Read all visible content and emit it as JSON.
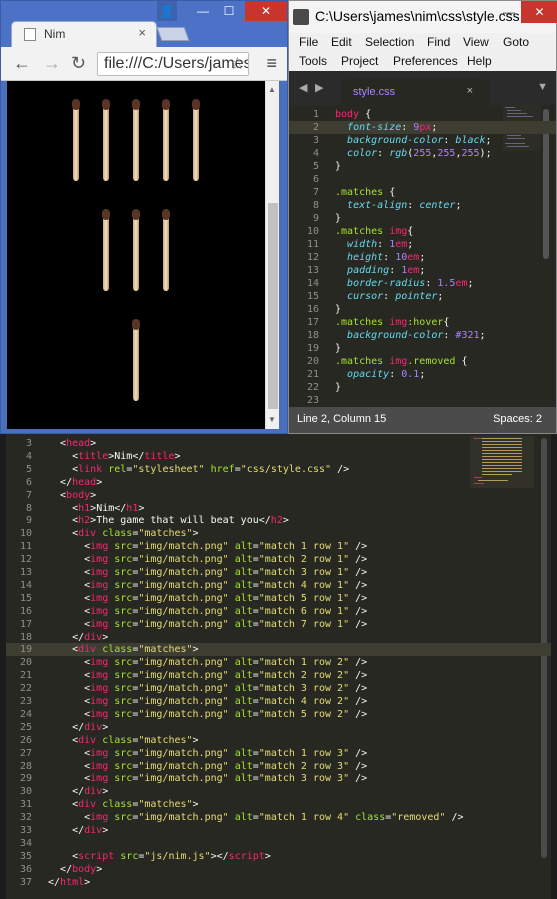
{
  "browser": {
    "tab_title": "Nim",
    "tab_close": "×",
    "url": "file:///C:/Users/james/nim/index.html",
    "win_user": "👤",
    "win_min": "—",
    "win_max": "☐",
    "win_close": "✕",
    "back": "←",
    "forward": "→",
    "reload": "↻",
    "star": "☆",
    "menu": "≡",
    "scroll_up": "▲",
    "scroll_down": "▼",
    "page_bg": "#000000",
    "match_rows": [
      5,
      3,
      1
    ],
    "removed_row": 3
  },
  "css_editor": {
    "window_title": "C:\\Users\\james\\nim\\css\\style.css",
    "win_min": "—",
    "win_close": "✕",
    "menu": [
      "File",
      "Edit",
      "Selection",
      "Find",
      "View",
      "Goto",
      "Tools",
      "Project",
      "Preferences",
      "Help"
    ],
    "tab_name": "style.css",
    "tab_close": "×",
    "prev": "◀",
    "next": "▶",
    "tab_dropdown": "▼",
    "status_left": "Line 2, Column 15",
    "status_right": "Spaces: 2",
    "current_line": 2,
    "lines": [
      {
        "n": "1",
        "html": "<span class='t'>body</span><span class='p'> {</span>"
      },
      {
        "n": "2",
        "html": "  <span class='k'>font-size</span><span class='p'>: </span><span class='n'>9</span><span class='t'>px</span><span class='p'>;</span>"
      },
      {
        "n": "3",
        "html": "  <span class='k'>background-color</span><span class='p'>: </span><span class='k'>black</span><span class='p'>;</span>"
      },
      {
        "n": "4",
        "html": "  <span class='k'>color</span><span class='p'>: </span><span class='k'>rgb</span><span class='p'>(</span><span class='n'>255</span><span class='p'>,</span><span class='n'>255</span><span class='p'>,</span><span class='n'>255</span><span class='p'>);</span>"
      },
      {
        "n": "5",
        "html": "<span class='p'>}</span>"
      },
      {
        "n": "6",
        "html": ""
      },
      {
        "n": "7",
        "html": "<span class='c'>.matches</span><span class='p'> {</span>"
      },
      {
        "n": "8",
        "html": "  <span class='k'>text-align</span><span class='p'>: </span><span class='k'>center</span><span class='p'>;</span>"
      },
      {
        "n": "9",
        "html": "<span class='p'>}</span>"
      },
      {
        "n": "10",
        "html": "<span class='c'>.matches</span><span class='p'> </span><span class='t'>img</span><span class='p'>{</span>"
      },
      {
        "n": "11",
        "html": "  <span class='k'>width</span><span class='p'>: </span><span class='n'>1</span><span class='t'>em</span><span class='p'>;</span>"
      },
      {
        "n": "12",
        "html": "  <span class='k'>height</span><span class='p'>: </span><span class='n'>10</span><span class='t'>em</span><span class='p'>;</span>"
      },
      {
        "n": "13",
        "html": "  <span class='k'>padding</span><span class='p'>: </span><span class='n'>1</span><span class='t'>em</span><span class='p'>;</span>"
      },
      {
        "n": "14",
        "html": "  <span class='k'>border-radius</span><span class='p'>: </span><span class='n'>1.5</span><span class='t'>em</span><span class='p'>;</span>"
      },
      {
        "n": "15",
        "html": "  <span class='k'>cursor</span><span class='p'>: </span><span class='k'>pointer</span><span class='p'>;</span>"
      },
      {
        "n": "16",
        "html": "<span class='p'>}</span>"
      },
      {
        "n": "17",
        "html": "<span class='c'>.matches</span><span class='p'> </span><span class='t'>img</span><span class='c'>:hover</span><span class='p'>{</span>"
      },
      {
        "n": "18",
        "html": "  <span class='k'>background-color</span><span class='p'>: </span><span class='n'>#321</span><span class='p'>;</span>"
      },
      {
        "n": "19",
        "html": "<span class='p'>}</span>"
      },
      {
        "n": "20",
        "html": "<span class='c'>.matches</span><span class='p'> </span><span class='t'>img</span><span class='c'>.removed</span><span class='p'> {</span>"
      },
      {
        "n": "21",
        "html": "  <span class='k'>opacity</span><span class='p'>: </span><span class='n'>0.1</span><span class='p'>;</span>"
      },
      {
        "n": "22",
        "html": "<span class='p'>}</span>"
      },
      {
        "n": "23",
        "html": ""
      }
    ]
  },
  "html_editor": {
    "current_line": 19,
    "lines": [
      {
        "n": "3",
        "html": "  <span class='p'>&lt;</span><span class='t'>head</span><span class='p'>&gt;</span>"
      },
      {
        "n": "4",
        "html": "    <span class='p'>&lt;</span><span class='t'>title</span><span class='p'>&gt;Nim&lt;/</span><span class='t'>title</span><span class='p'>&gt;</span>"
      },
      {
        "n": "5",
        "html": "    <span class='p'>&lt;</span><span class='t'>link</span> <span class='a'>rel</span><span class='p'>=</span><span class='s'>\"stylesheet\"</span> <span class='a'>href</span><span class='p'>=</span><span class='s'>\"css/style.css\"</span><span class='p'> /&gt;</span>"
      },
      {
        "n": "6",
        "html": "  <span class='p'>&lt;/</span><span class='t'>head</span><span class='p'>&gt;</span>"
      },
      {
        "n": "7",
        "html": "  <span class='p'>&lt;</span><span class='t'>body</span><span class='p'>&gt;</span>"
      },
      {
        "n": "8",
        "html": "    <span class='p'>&lt;</span><span class='t'>h1</span><span class='p'>&gt;Nim&lt;/</span><span class='t'>h1</span><span class='p'>&gt;</span>"
      },
      {
        "n": "9",
        "html": "    <span class='p'>&lt;</span><span class='t'>h2</span><span class='p'>&gt;The game that will beat you&lt;/</span><span class='t'>h2</span><span class='p'>&gt;</span>"
      },
      {
        "n": "10",
        "html": "    <span class='p'>&lt;</span><span class='t'>div</span> <span class='a'>class</span><span class='p'>=</span><span class='s'>\"matches\"</span><span class='p'>&gt;</span>"
      },
      {
        "n": "11",
        "html": "      <span class='p'>&lt;</span><span class='t'>img</span> <span class='a'>src</span><span class='p'>=</span><span class='s'>\"img/match.png\"</span> <span class='a'>alt</span><span class='p'>=</span><span class='s'>\"match 1 row 1\"</span><span class='p'> /&gt;</span>"
      },
      {
        "n": "12",
        "html": "      <span class='p'>&lt;</span><span class='t'>img</span> <span class='a'>src</span><span class='p'>=</span><span class='s'>\"img/match.png\"</span> <span class='a'>alt</span><span class='p'>=</span><span class='s'>\"match 2 row 1\"</span><span class='p'> /&gt;</span>"
      },
      {
        "n": "13",
        "html": "      <span class='p'>&lt;</span><span class='t'>img</span> <span class='a'>src</span><span class='p'>=</span><span class='s'>\"img/match.png\"</span> <span class='a'>alt</span><span class='p'>=</span><span class='s'>\"match 3 row 1\"</span><span class='p'> /&gt;</span>"
      },
      {
        "n": "14",
        "html": "      <span class='p'>&lt;</span><span class='t'>img</span> <span class='a'>src</span><span class='p'>=</span><span class='s'>\"img/match.png\"</span> <span class='a'>alt</span><span class='p'>=</span><span class='s'>\"match 4 row 1\"</span><span class='p'> /&gt;</span>"
      },
      {
        "n": "15",
        "html": "      <span class='p'>&lt;</span><span class='t'>img</span> <span class='a'>src</span><span class='p'>=</span><span class='s'>\"img/match.png\"</span> <span class='a'>alt</span><span class='p'>=</span><span class='s'>\"match 5 row 1\"</span><span class='p'> /&gt;</span>"
      },
      {
        "n": "16",
        "html": "      <span class='p'>&lt;</span><span class='t'>img</span> <span class='a'>src</span><span class='p'>=</span><span class='s'>\"img/match.png\"</span> <span class='a'>alt</span><span class='p'>=</span><span class='s'>\"match 6 row 1\"</span><span class='p'> /&gt;</span>"
      },
      {
        "n": "17",
        "html": "      <span class='p'>&lt;</span><span class='t'>img</span> <span class='a'>src</span><span class='p'>=</span><span class='s'>\"img/match.png\"</span> <span class='a'>alt</span><span class='p'>=</span><span class='s'>\"match 7 row 1\"</span><span class='p'> /&gt;</span>"
      },
      {
        "n": "18",
        "html": "    <span class='p'>&lt;/</span><span class='t'>div</span><span class='p'>&gt;</span>"
      },
      {
        "n": "19",
        "html": "    <span class='p'>&lt;</span><span class='t'>div</span> <span class='a'>class</span><span class='p'>=</span><span class='s'>\"matches\"</span><span class='p'>&gt;</span>"
      },
      {
        "n": "20",
        "html": "      <span class='p'>&lt;</span><span class='t'>img</span> <span class='a'>src</span><span class='p'>=</span><span class='s'>\"img/match.png\"</span> <span class='a'>alt</span><span class='p'>=</span><span class='s'>\"match 1 row 2\"</span><span class='p'> /&gt;</span>"
      },
      {
        "n": "21",
        "html": "      <span class='p'>&lt;</span><span class='t'>img</span> <span class='a'>src</span><span class='p'>=</span><span class='s'>\"img/match.png\"</span> <span class='a'>alt</span><span class='p'>=</span><span class='s'>\"match 2 row 2\"</span><span class='p'> /&gt;</span>"
      },
      {
        "n": "22",
        "html": "      <span class='p'>&lt;</span><span class='t'>img</span> <span class='a'>src</span><span class='p'>=</span><span class='s'>\"img/match.png\"</span> <span class='a'>alt</span><span class='p'>=</span><span class='s'>\"match 3 row 2\"</span><span class='p'> /&gt;</span>"
      },
      {
        "n": "23",
        "html": "      <span class='p'>&lt;</span><span class='t'>img</span> <span class='a'>src</span><span class='p'>=</span><span class='s'>\"img/match.png\"</span> <span class='a'>alt</span><span class='p'>=</span><span class='s'>\"match 4 row 2\"</span><span class='p'> /&gt;</span>"
      },
      {
        "n": "24",
        "html": "      <span class='p'>&lt;</span><span class='t'>img</span> <span class='a'>src</span><span class='p'>=</span><span class='s'>\"img/match.png\"</span> <span class='a'>alt</span><span class='p'>=</span><span class='s'>\"match 5 row 2\"</span><span class='p'> /&gt;</span>"
      },
      {
        "n": "25",
        "html": "    <span class='p'>&lt;/</span><span class='t'>div</span><span class='p'>&gt;</span>"
      },
      {
        "n": "26",
        "html": "    <span class='p'>&lt;</span><span class='t'>div</span> <span class='a'>class</span><span class='p'>=</span><span class='s'>\"matches\"</span><span class='p'>&gt;</span>"
      },
      {
        "n": "27",
        "html": "      <span class='p'>&lt;</span><span class='t'>img</span> <span class='a'>src</span><span class='p'>=</span><span class='s'>\"img/match.png\"</span> <span class='a'>alt</span><span class='p'>=</span><span class='s'>\"match 1 row 3\"</span><span class='p'> /&gt;</span>"
      },
      {
        "n": "28",
        "html": "      <span class='p'>&lt;</span><span class='t'>img</span> <span class='a'>src</span><span class='p'>=</span><span class='s'>\"img/match.png\"</span> <span class='a'>alt</span><span class='p'>=</span><span class='s'>\"match 2 row 3\"</span><span class='p'> /&gt;</span>"
      },
      {
        "n": "29",
        "html": "      <span class='p'>&lt;</span><span class='t'>img</span> <span class='a'>src</span><span class='p'>=</span><span class='s'>\"img/match.png\"</span> <span class='a'>alt</span><span class='p'>=</span><span class='s'>\"match 3 row 3\"</span><span class='p'> /&gt;</span>"
      },
      {
        "n": "30",
        "html": "    <span class='p'>&lt;/</span><span class='t'>div</span><span class='p'>&gt;</span>"
      },
      {
        "n": "31",
        "html": "    <span class='p'>&lt;</span><span class='t'>div</span> <span class='a'>class</span><span class='p'>=</span><span class='s'>\"matches\"</span><span class='p'>&gt;</span>"
      },
      {
        "n": "32",
        "html": "      <span class='p'>&lt;</span><span class='t'>img</span> <span class='a'>src</span><span class='p'>=</span><span class='s'>\"img/match.png\"</span> <span class='a'>alt</span><span class='p'>=</span><span class='s'>\"match 1 row 4\"</span> <span class='a'>class</span><span class='p'>=</span><span class='s'>\"removed\"</span><span class='p'> /&gt;</span>"
      },
      {
        "n": "33",
        "html": "    <span class='p'>&lt;/</span><span class='t'>div</span><span class='p'>&gt;</span>"
      },
      {
        "n": "34",
        "html": ""
      },
      {
        "n": "35",
        "html": "    <span class='p'>&lt;</span><span class='t'>script</span> <span class='a'>src</span><span class='p'>=</span><span class='s'>\"js/nim.js\"</span><span class='p'>&gt;&lt;/</span><span class='t'>script</span><span class='p'>&gt;</span>"
      },
      {
        "n": "36",
        "html": "  <span class='p'>&lt;/</span><span class='t'>body</span><span class='p'>&gt;</span>"
      },
      {
        "n": "37",
        "html": "<span class='p'>&lt;/</span><span class='t'>html</span><span class='p'>&gt;</span>"
      }
    ]
  }
}
